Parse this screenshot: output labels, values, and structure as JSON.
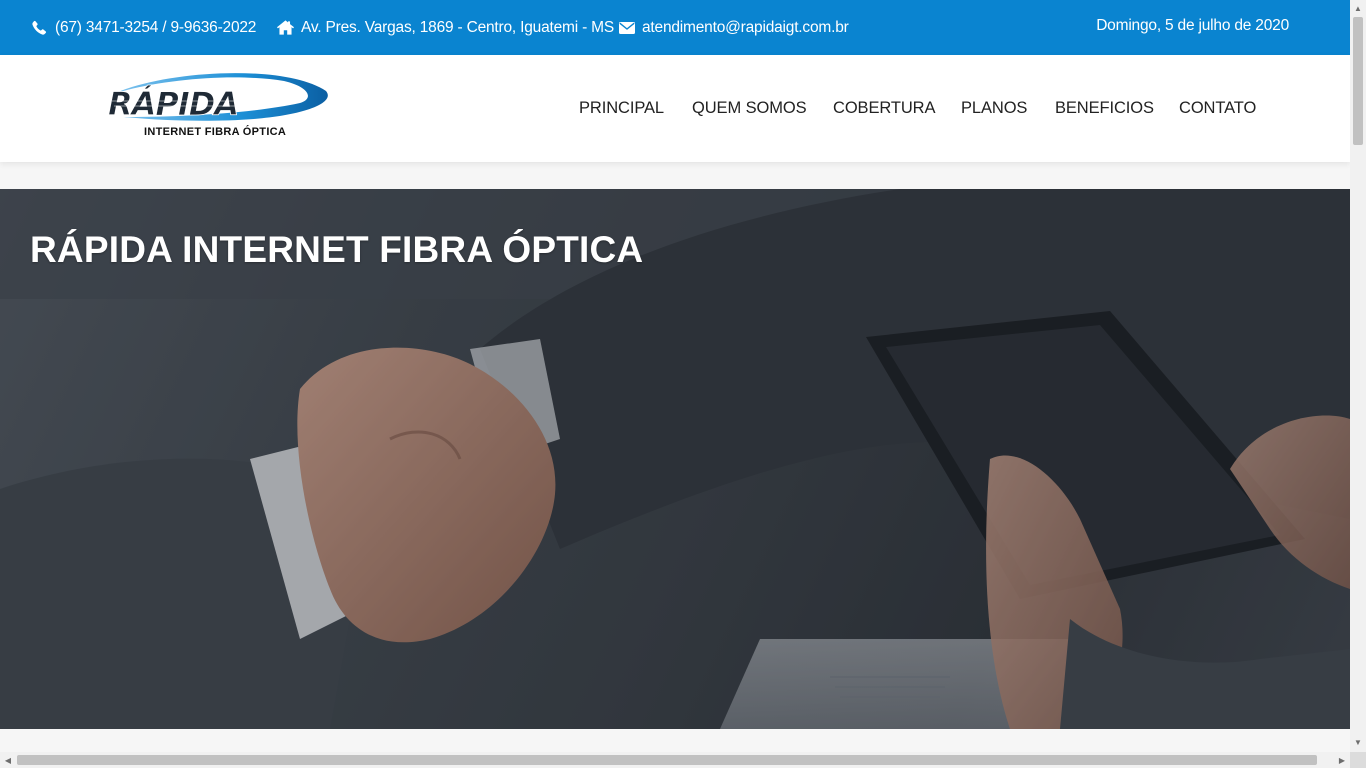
{
  "topbar": {
    "phone": "(67) 3471-3254 / 9-9636-2022",
    "address": "Av. Pres. Vargas, 1869 - Centro, Iguatemi - MS",
    "email": "atendimento@rapidaigt.com.br",
    "date": "Domingo, 5 de julho de 2020",
    "icons": {
      "phone": "phone-icon",
      "address": "home-icon",
      "email": "envelope-icon"
    }
  },
  "logo": {
    "brand": "RÁPIDA",
    "subtitle": "INTERNET FIBRA ÓPTICA"
  },
  "nav": {
    "items": [
      "PRINCIPAL",
      "QUEM SOMOS",
      "COBERTURA",
      "PLANOS",
      "BENEFICIOS",
      "CONTATO"
    ]
  },
  "hero": {
    "title": "RÁPIDA INTERNET FIBRA ÓPTICA"
  },
  "colors": {
    "topbar": "#0a84d0",
    "logo_blue": "#1c8fd6",
    "nav_text": "#222222",
    "hero_overlay": "#33393f"
  }
}
